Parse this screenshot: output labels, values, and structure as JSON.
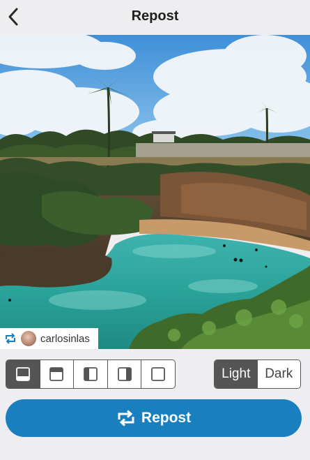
{
  "header": {
    "title": "Repost",
    "back_icon": "chevron-left-icon"
  },
  "photo": {
    "description_icon": "photo",
    "attribution": {
      "icon": "repost-icon",
      "username": "carlosinlas"
    }
  },
  "layout_options": [
    {
      "icon": "layout-bottom-bar-icon",
      "selected": true
    },
    {
      "icon": "layout-top-bar-icon",
      "selected": false
    },
    {
      "icon": "layout-left-bar-icon",
      "selected": false
    },
    {
      "icon": "layout-right-bar-icon",
      "selected": false
    },
    {
      "icon": "layout-none-icon",
      "selected": false
    }
  ],
  "theme": {
    "light_label": "Light",
    "dark_label": "Dark",
    "selected": "Light"
  },
  "repost_button": {
    "label": "Repost",
    "icon": "repost-icon"
  },
  "colors": {
    "accent": "#1a7fbf",
    "background": "#eeeef0",
    "selected_segment": "#555555"
  }
}
